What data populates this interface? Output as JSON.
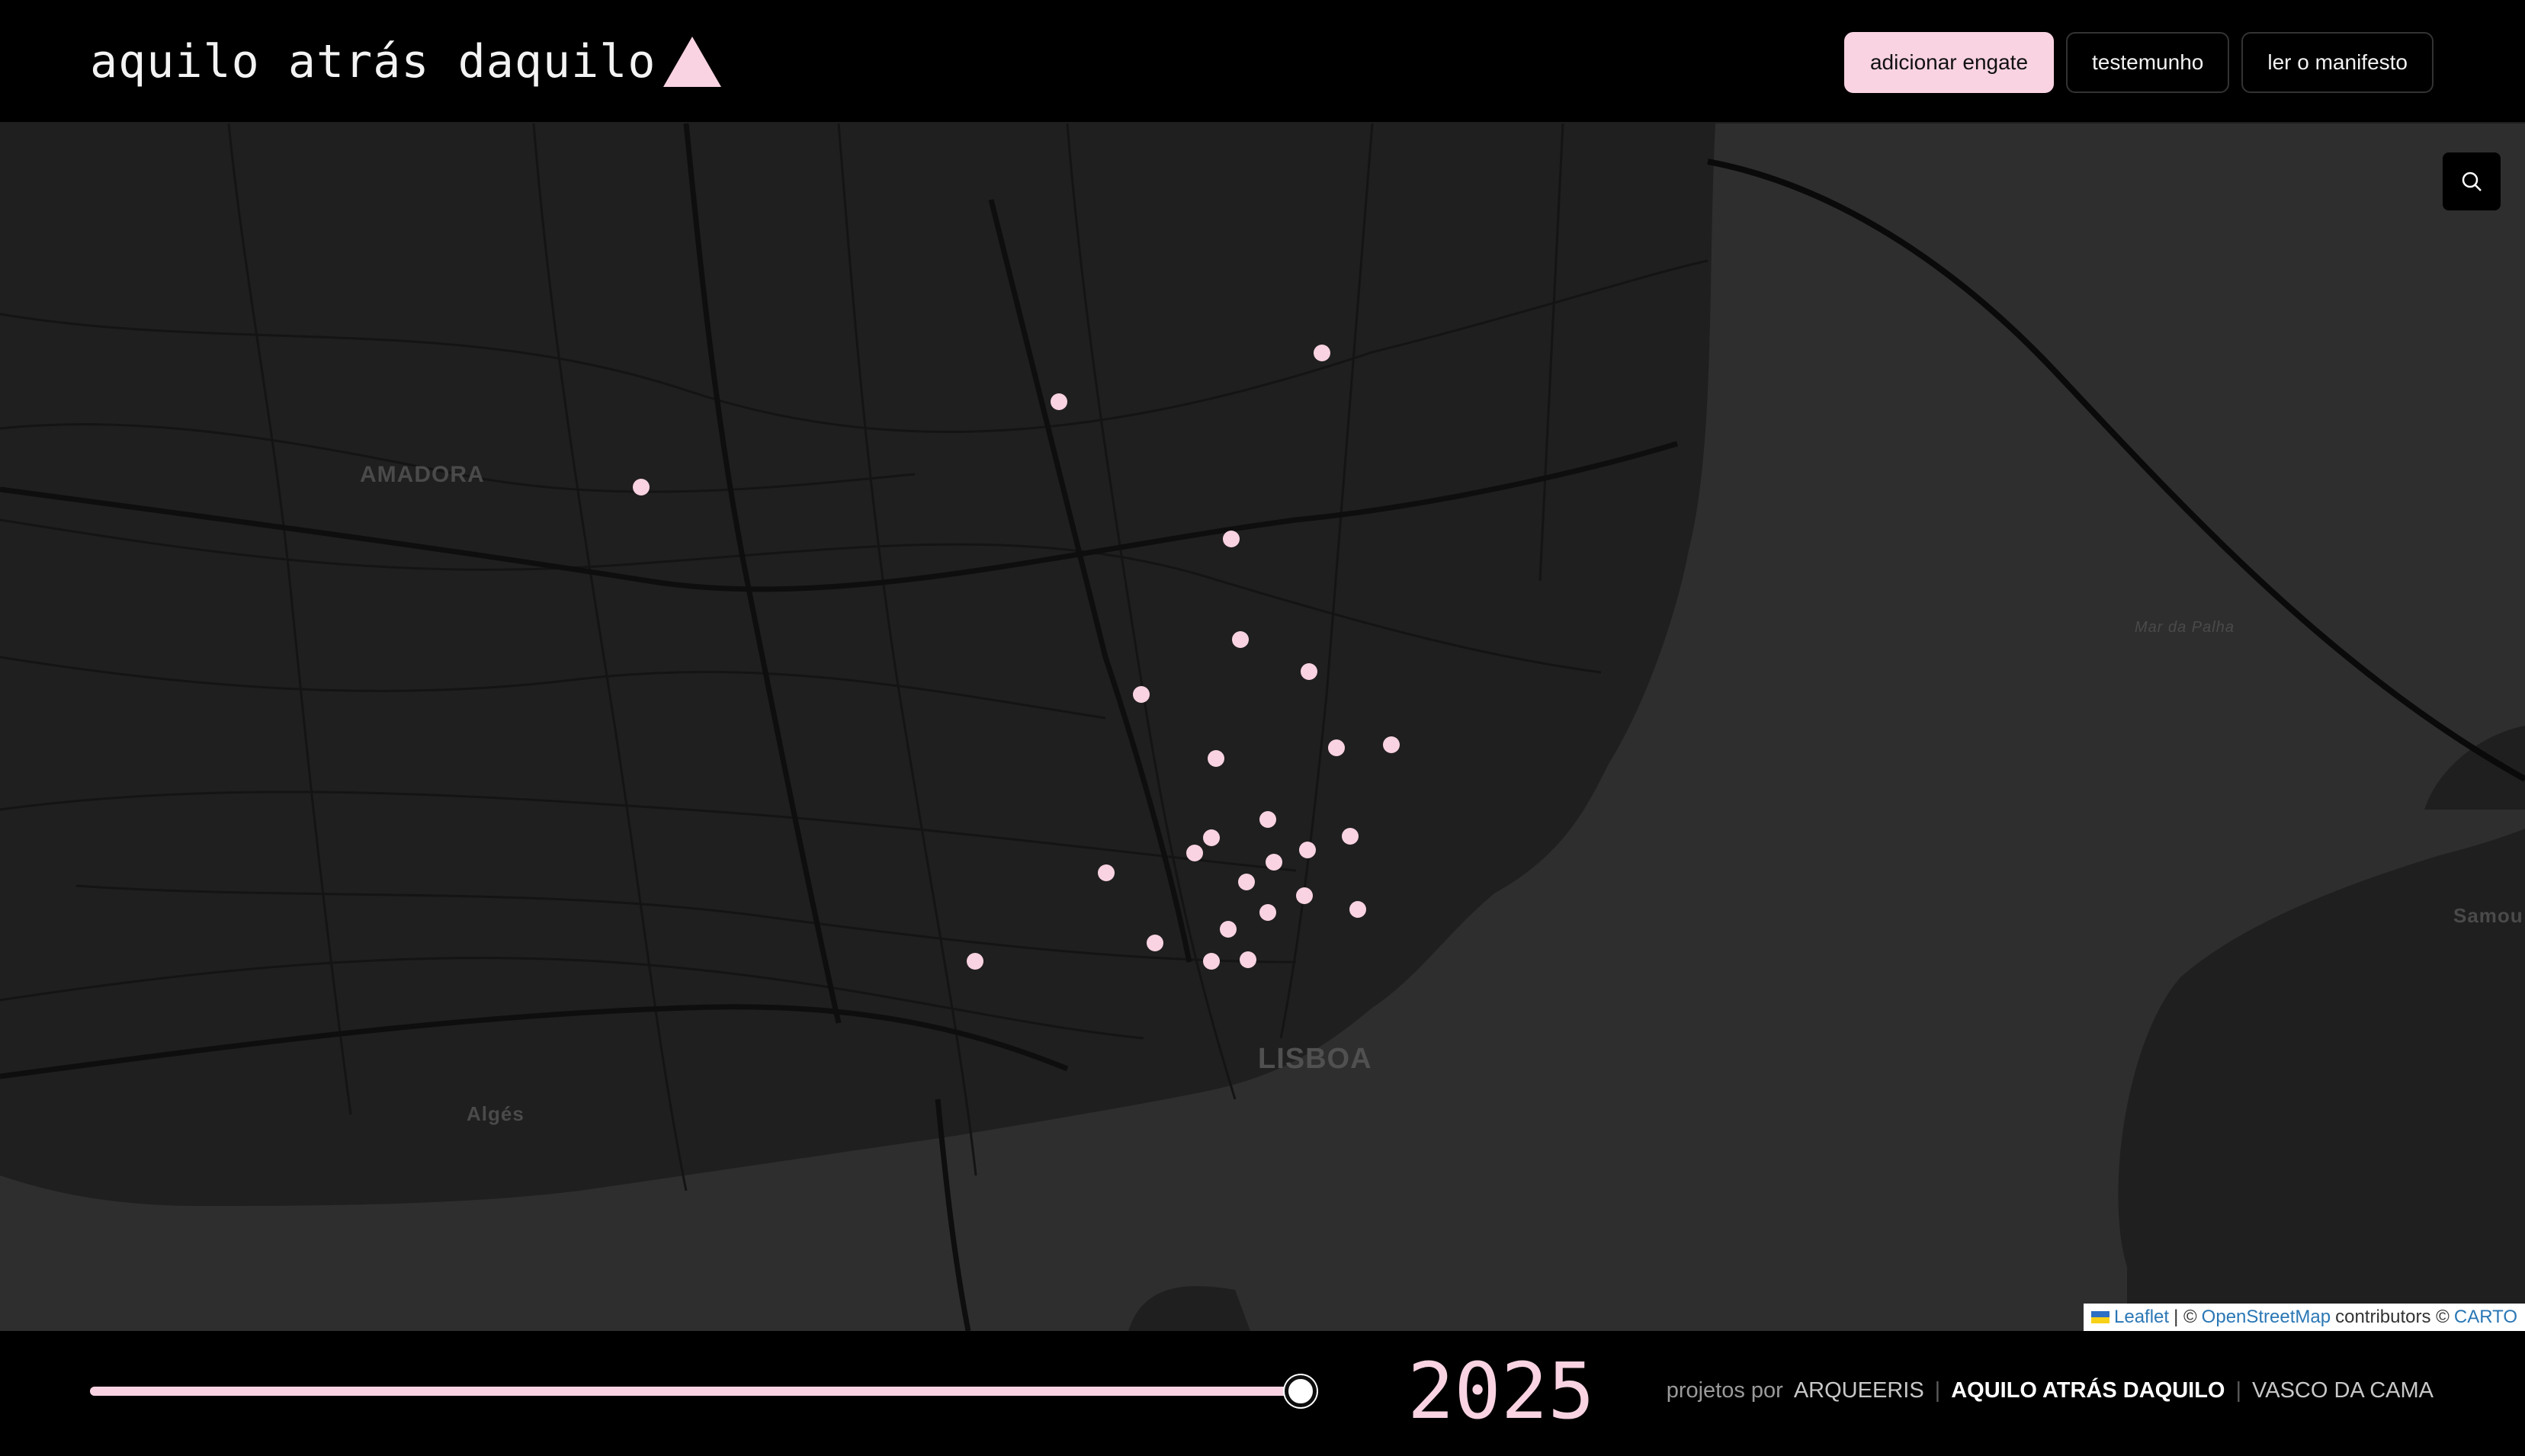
{
  "header": {
    "logo_text": "aquilo atrás daquilo",
    "buttons": {
      "add": "adicionar engate",
      "testimony": "testemunho",
      "manifesto": "ler o manifesto"
    }
  },
  "map": {
    "labels": {
      "amadora": "AMADORA",
      "lisboa": "LISBOA",
      "alges": "Algés",
      "samouco": "Samou",
      "mar_da_palha": "Mar da Palha"
    },
    "attribution": {
      "leaflet": "Leaflet",
      "sep1": "| ©",
      "osm": "OpenStreetMap",
      "contrib": "contributors ©",
      "carto": "CARTO"
    },
    "marker_color": "#f9d3e2"
  },
  "timeline": {
    "year": "2025",
    "slider_value": 1.0
  },
  "footer": {
    "credits_prefix": "projetos por",
    "projects": [
      "ARQUEERIS",
      "AQUILO ATRÁS DAQUILO",
      "VASCO DA CAMA"
    ],
    "active_index": 1
  },
  "colors": {
    "accent": "#f9d3e2",
    "background": "#000000",
    "land": "#272727",
    "water": "#2f2f2f"
  }
}
